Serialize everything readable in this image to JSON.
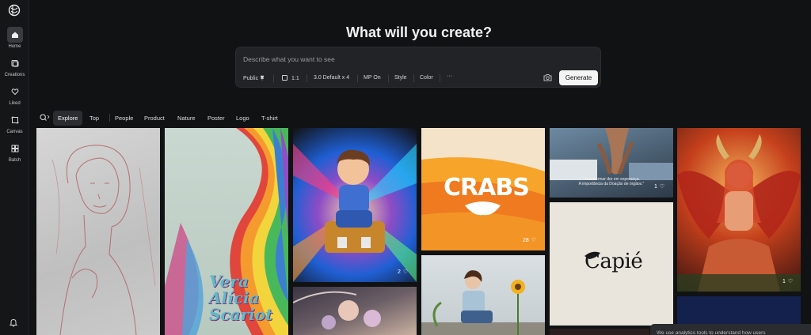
{
  "sidebar": {
    "items": [
      {
        "label": "Home",
        "icon": "home-icon"
      },
      {
        "label": "Creations",
        "icon": "creations-icon"
      },
      {
        "label": "Liked",
        "icon": "heart-icon"
      },
      {
        "label": "Canvas",
        "icon": "canvas-icon"
      },
      {
        "label": "Batch",
        "icon": "batch-icon"
      }
    ]
  },
  "heading": "What will you create?",
  "prompt": {
    "placeholder": "Describe what you want to see",
    "options": {
      "visibility": "Public",
      "ratio": "1:1",
      "model": "3.0 Default x 4",
      "mp": "MP On",
      "style": "Style",
      "color": "Color",
      "more": "···"
    },
    "generate_label": "Generate"
  },
  "tabs": [
    "Explore",
    "Top",
    "People",
    "Product",
    "Nature",
    "Poster",
    "Logo",
    "T-shirt"
  ],
  "gallery": {
    "vera_text": "Vera\nAlícia\nScariot",
    "crabs_text": "CRABS",
    "capie_text": "Capié",
    "hands_caption": "\"Transformar dor em esperança.\nA importância da Doação de órgãos.\"",
    "likes": {
      "boy": "2",
      "crabs": "28",
      "hands": "1",
      "demon": "1"
    }
  },
  "cookie_text": "We use analytics tools to understand how users",
  "colors": {
    "background": "#111214",
    "card": "#222326",
    "accent_orange": "#ef7a1f"
  }
}
